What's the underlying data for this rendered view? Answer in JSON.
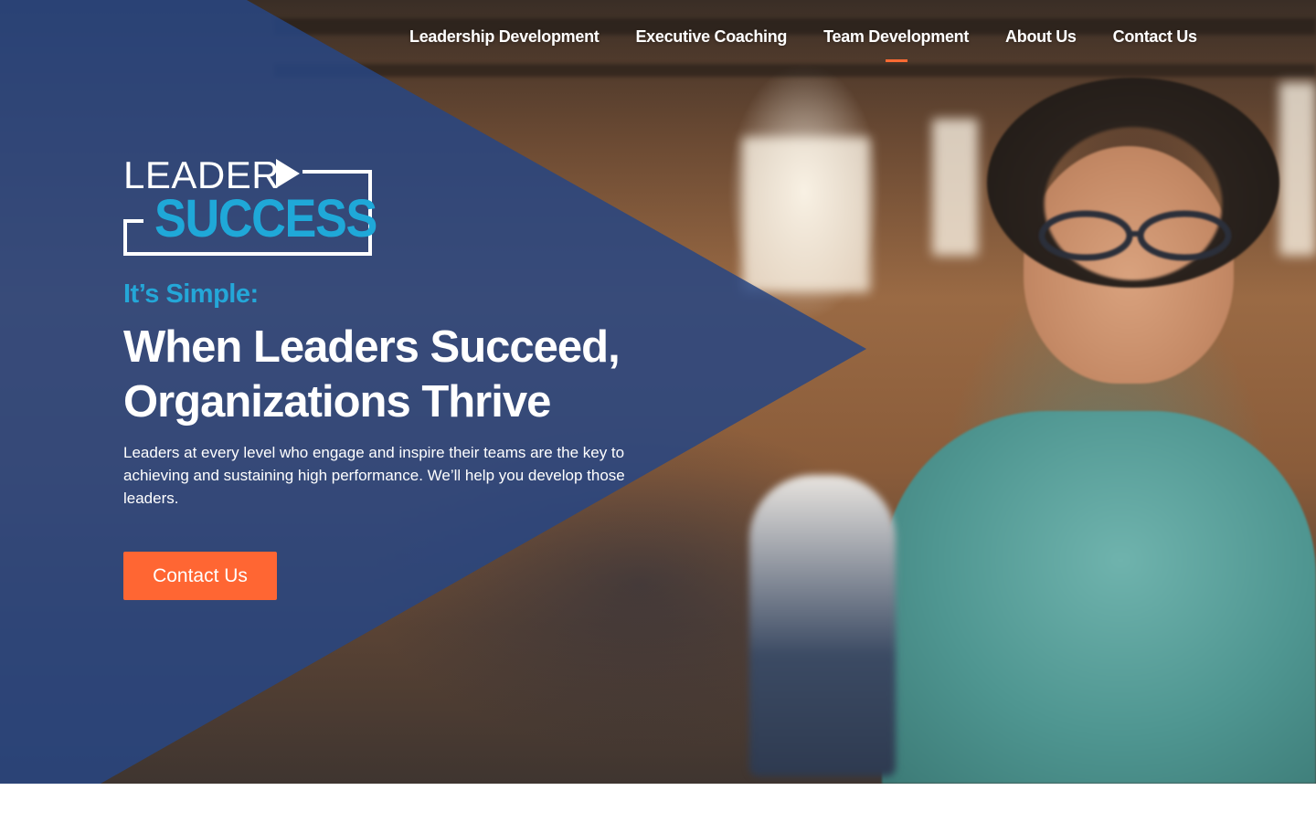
{
  "nav": {
    "items": [
      {
        "label": "Leadership Development",
        "active": false
      },
      {
        "label": "Executive Coaching",
        "active": false
      },
      {
        "label": "Team Development",
        "active": true
      },
      {
        "label": "About Us",
        "active": false
      },
      {
        "label": "Contact Us",
        "active": false
      }
    ]
  },
  "logo": {
    "line1": "LEADER",
    "line2": "SUCCESS"
  },
  "hero": {
    "kicker": "It’s Simple:",
    "headline_line1": "When Leaders Succeed,",
    "headline_line2": "Organizations Thrive",
    "body": "Leaders at every level who engage and inspire their teams are the key to achieving and sustaining high performance. We’ll help you develop those leaders.",
    "cta_label": "Contact Us"
  },
  "colors": {
    "overlay": "#2d4a86",
    "accent_orange": "#ff6633",
    "accent_blue": "#24a7d8",
    "text": "#ffffff"
  }
}
